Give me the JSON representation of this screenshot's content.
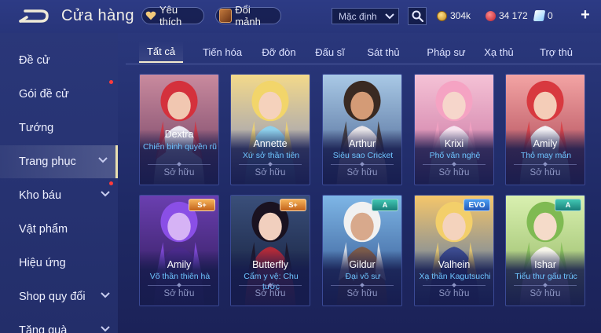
{
  "header": {
    "title": "Cửa hàng",
    "favorites_label": "Yêu thích",
    "shards_label": "Đổi mảnh",
    "sort_value": "Mặc định",
    "gold": "304k",
    "rubies": "34 172",
    "vouchers": "0",
    "plus": "+"
  },
  "sidebar": {
    "items": [
      {
        "label": "Đề cử",
        "dot": false,
        "chevron": false
      },
      {
        "label": "Gói đề cử",
        "dot": true,
        "chevron": false
      },
      {
        "label": "Tướng",
        "dot": false,
        "chevron": false
      },
      {
        "label": "Trang phục",
        "dot": false,
        "chevron": true,
        "active": true
      },
      {
        "label": "Kho báu",
        "dot": true,
        "chevron": true
      },
      {
        "label": "Vật phẩm",
        "dot": false,
        "chevron": false
      },
      {
        "label": "Hiệu ứng",
        "dot": false,
        "chevron": false
      },
      {
        "label": "Shop quy đổi",
        "dot": false,
        "chevron": true
      },
      {
        "label": "Tặng quà",
        "dot": false,
        "chevron": true
      }
    ]
  },
  "tabs": [
    "Tất cả",
    "Tiến hóa",
    "Đỡ đòn",
    "Đấu sĩ",
    "Sát thủ",
    "Pháp sư",
    "Xạ thủ",
    "Trợ thủ"
  ],
  "cards": [
    {
      "hero": "Dextra",
      "skin": "Chiến binh quyền rũ",
      "status": "Sở hữu",
      "badge": ""
    },
    {
      "hero": "Annette",
      "skin": "Xứ sở thần tiên",
      "status": "Sở hữu",
      "badge": ""
    },
    {
      "hero": "Arthur",
      "skin": "Siêu sao Cricket",
      "status": "Sở hữu",
      "badge": ""
    },
    {
      "hero": "Krixi",
      "skin": "Phố văn nghệ",
      "status": "Sở hữu",
      "badge": ""
    },
    {
      "hero": "Amily",
      "skin": "Thỏ may mắn",
      "status": "Sở hữu",
      "badge": ""
    },
    {
      "hero": "Amily",
      "skin": "Võ thần thiên hà",
      "status": "Sở hữu",
      "badge": "S+"
    },
    {
      "hero": "Butterfly",
      "skin": "Cẩm y vệ: Chu tước",
      "status": "Sở hữu",
      "badge": "S+"
    },
    {
      "hero": "Gildur",
      "skin": "Đại võ sư",
      "status": "Sở hữu",
      "badge": "A"
    },
    {
      "hero": "Valhein",
      "skin": "Xạ thần Kagutsuchi",
      "status": "Sở hữu",
      "badge": "EVO"
    },
    {
      "hero": "Ishar",
      "skin": "Tiểu thư gấu trúc",
      "status": "Sở hữu",
      "badge": "A"
    }
  ],
  "colors": {
    "background": "#25316f",
    "skin_name": "#6ec4ff",
    "owned_text": "#8e96c4",
    "active_accent": "#f2ead0",
    "notification": "#ff3b3b"
  }
}
